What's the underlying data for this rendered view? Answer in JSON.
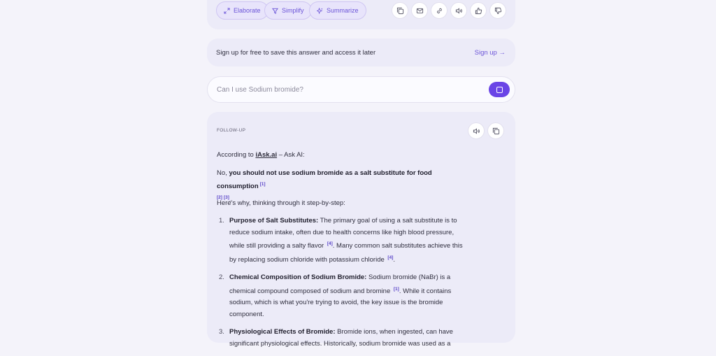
{
  "actions": {
    "elaborate": "Elaborate",
    "simplify": "Simplify",
    "summarize": "Summarize"
  },
  "signup": {
    "text": "Sign up for free to save this answer and access it later",
    "link": "Sign up →"
  },
  "search": {
    "value": "",
    "placeholder": "Can I use Sodium bromide?"
  },
  "answer": {
    "label": "FOLLOW-UP",
    "according_prefix": "According to ",
    "according_link": "iAsk.ai",
    "according_suffix": " – Ask AI:",
    "verdict_prefix": "No, ",
    "verdict_bold": "you should not use sodium bromide as a salt substitute for food consumption",
    "verdict_cites": [
      "[1]",
      "[2]",
      "[3]"
    ],
    "verdict_end": ".",
    "intro": "Here's why, thinking through it step-by-step:",
    "reasons": [
      {
        "num": "1.",
        "title": "Purpose of Salt Substitutes:",
        "p1": " The primary goal of using a salt substitute is to reduce sodium intake, often due to health concerns like high blood pressure, while still providing a salty flavor ",
        "c1": "[4]",
        "p2": ". Many common salt substitutes achieve this by replacing sodium chloride with potassium chloride ",
        "c2": "[4]",
        "p3": "."
      },
      {
        "num": "2.",
        "title": "Chemical Composition of Sodium Bromide:",
        "p1": " Sodium bromide (NaBr) is a chemical compound composed of sodium and bromine ",
        "c1": "[1]",
        "p2": ". While it contains sodium, which is what you're trying to avoid, the key issue is the bromide component.",
        "c2": "",
        "p3": ""
      },
      {
        "num": "3.",
        "title": "Physiological Effects of Bromide:",
        "p1": " Bromide ions, when ingested, can have significant physiological effects. Historically, sodium bromide was used as a",
        "c1": "",
        "p2": "",
        "c2": "",
        "p3": ""
      }
    ]
  },
  "colors": {
    "accent": "#6a45e6",
    "background": "#f4f3fa",
    "card": "#ecebf8"
  }
}
